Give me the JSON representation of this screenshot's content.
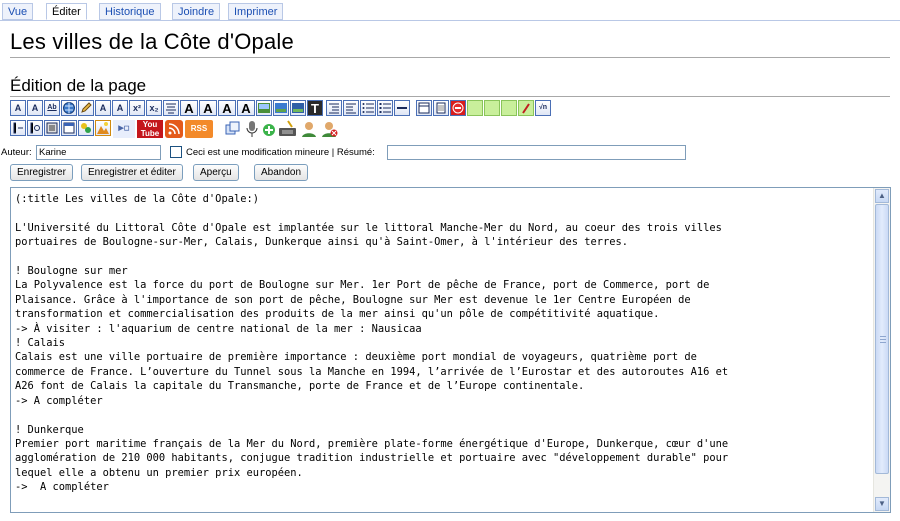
{
  "tabs": [
    {
      "label": "Vue"
    },
    {
      "label": "Éditer"
    },
    {
      "label": "Historique"
    },
    {
      "label": "Joindre"
    },
    {
      "label": "Imprimer"
    }
  ],
  "page_title": "Les villes de la Côte d'Opale",
  "edit_heading": "Édition de la page",
  "form": {
    "author_label": "Auteur:",
    "author_value": "Karine",
    "minor_label": "Ceci est une modification mineure | Résumé:",
    "summary_value": ""
  },
  "buttons": {
    "save": "Enregistrer",
    "save_edit": "Enregistrer et éditer",
    "preview": "Aperçu",
    "cancel": "Abandon"
  },
  "toolbar_icons": {
    "row1": [
      "A",
      "A",
      "Ab",
      "🌐",
      "/",
      "A",
      "A",
      "x²",
      "x₂",
      "☰",
      "A",
      "A",
      "A",
      "A"
    ],
    "row2_labels": [
      "You Tube",
      "RSS"
    ]
  },
  "editor": {
    "lines": [
      "(:title Les villes de la Côte d'Opale:)",
      "",
      "L'Université du Littoral Côte d'Opale est implantée sur le littoral Manche-Mer du Nord, au coeur des trois villes",
      "portuaires de Boulogne-sur-Mer, Calais, Dunkerque ainsi qu'à Saint-Omer, à l'intérieur des terres.",
      "",
      "! Boulogne sur mer",
      "La Polyvalence est la force du port de Boulogne sur Mer. 1er Port de pêche de France, port de Commerce, port de",
      "Plaisance. Grâce à l'importance de son port de pêche, Boulogne sur Mer est devenue le 1er Centre Européen de",
      "transformation et commercialisation des produits de la mer ainsi qu'un pôle de compétitivité aquatique.",
      "-> À visiter : l'aquarium de centre national de la mer : Nausicaa",
      "! Calais",
      "Calais est une ville portuaire de première importance : deuxième port mondial de voyageurs, quatrième port de",
      "commerce de France. L’ouverture du Tunnel sous la Manche en 1994, l’arrivée de l’Eurostar et des autoroutes A16 et",
      "A26 font de Calais la capitale du Transmanche, porte de France et de l’Europe continentale.",
      "-> A compléter",
      "",
      "! Dunkerque",
      "Premier port maritime français de la Mer du Nord, première plate-forme énergétique d'Europe, Dunkerque, cœur d'une",
      "agglomération de 210 000 habitants, conjugue tradition industrielle et portuaire avec \"développement durable\" pour",
      "lequel elle a obtenu un premier prix européen.",
      "->  A compléter"
    ]
  }
}
